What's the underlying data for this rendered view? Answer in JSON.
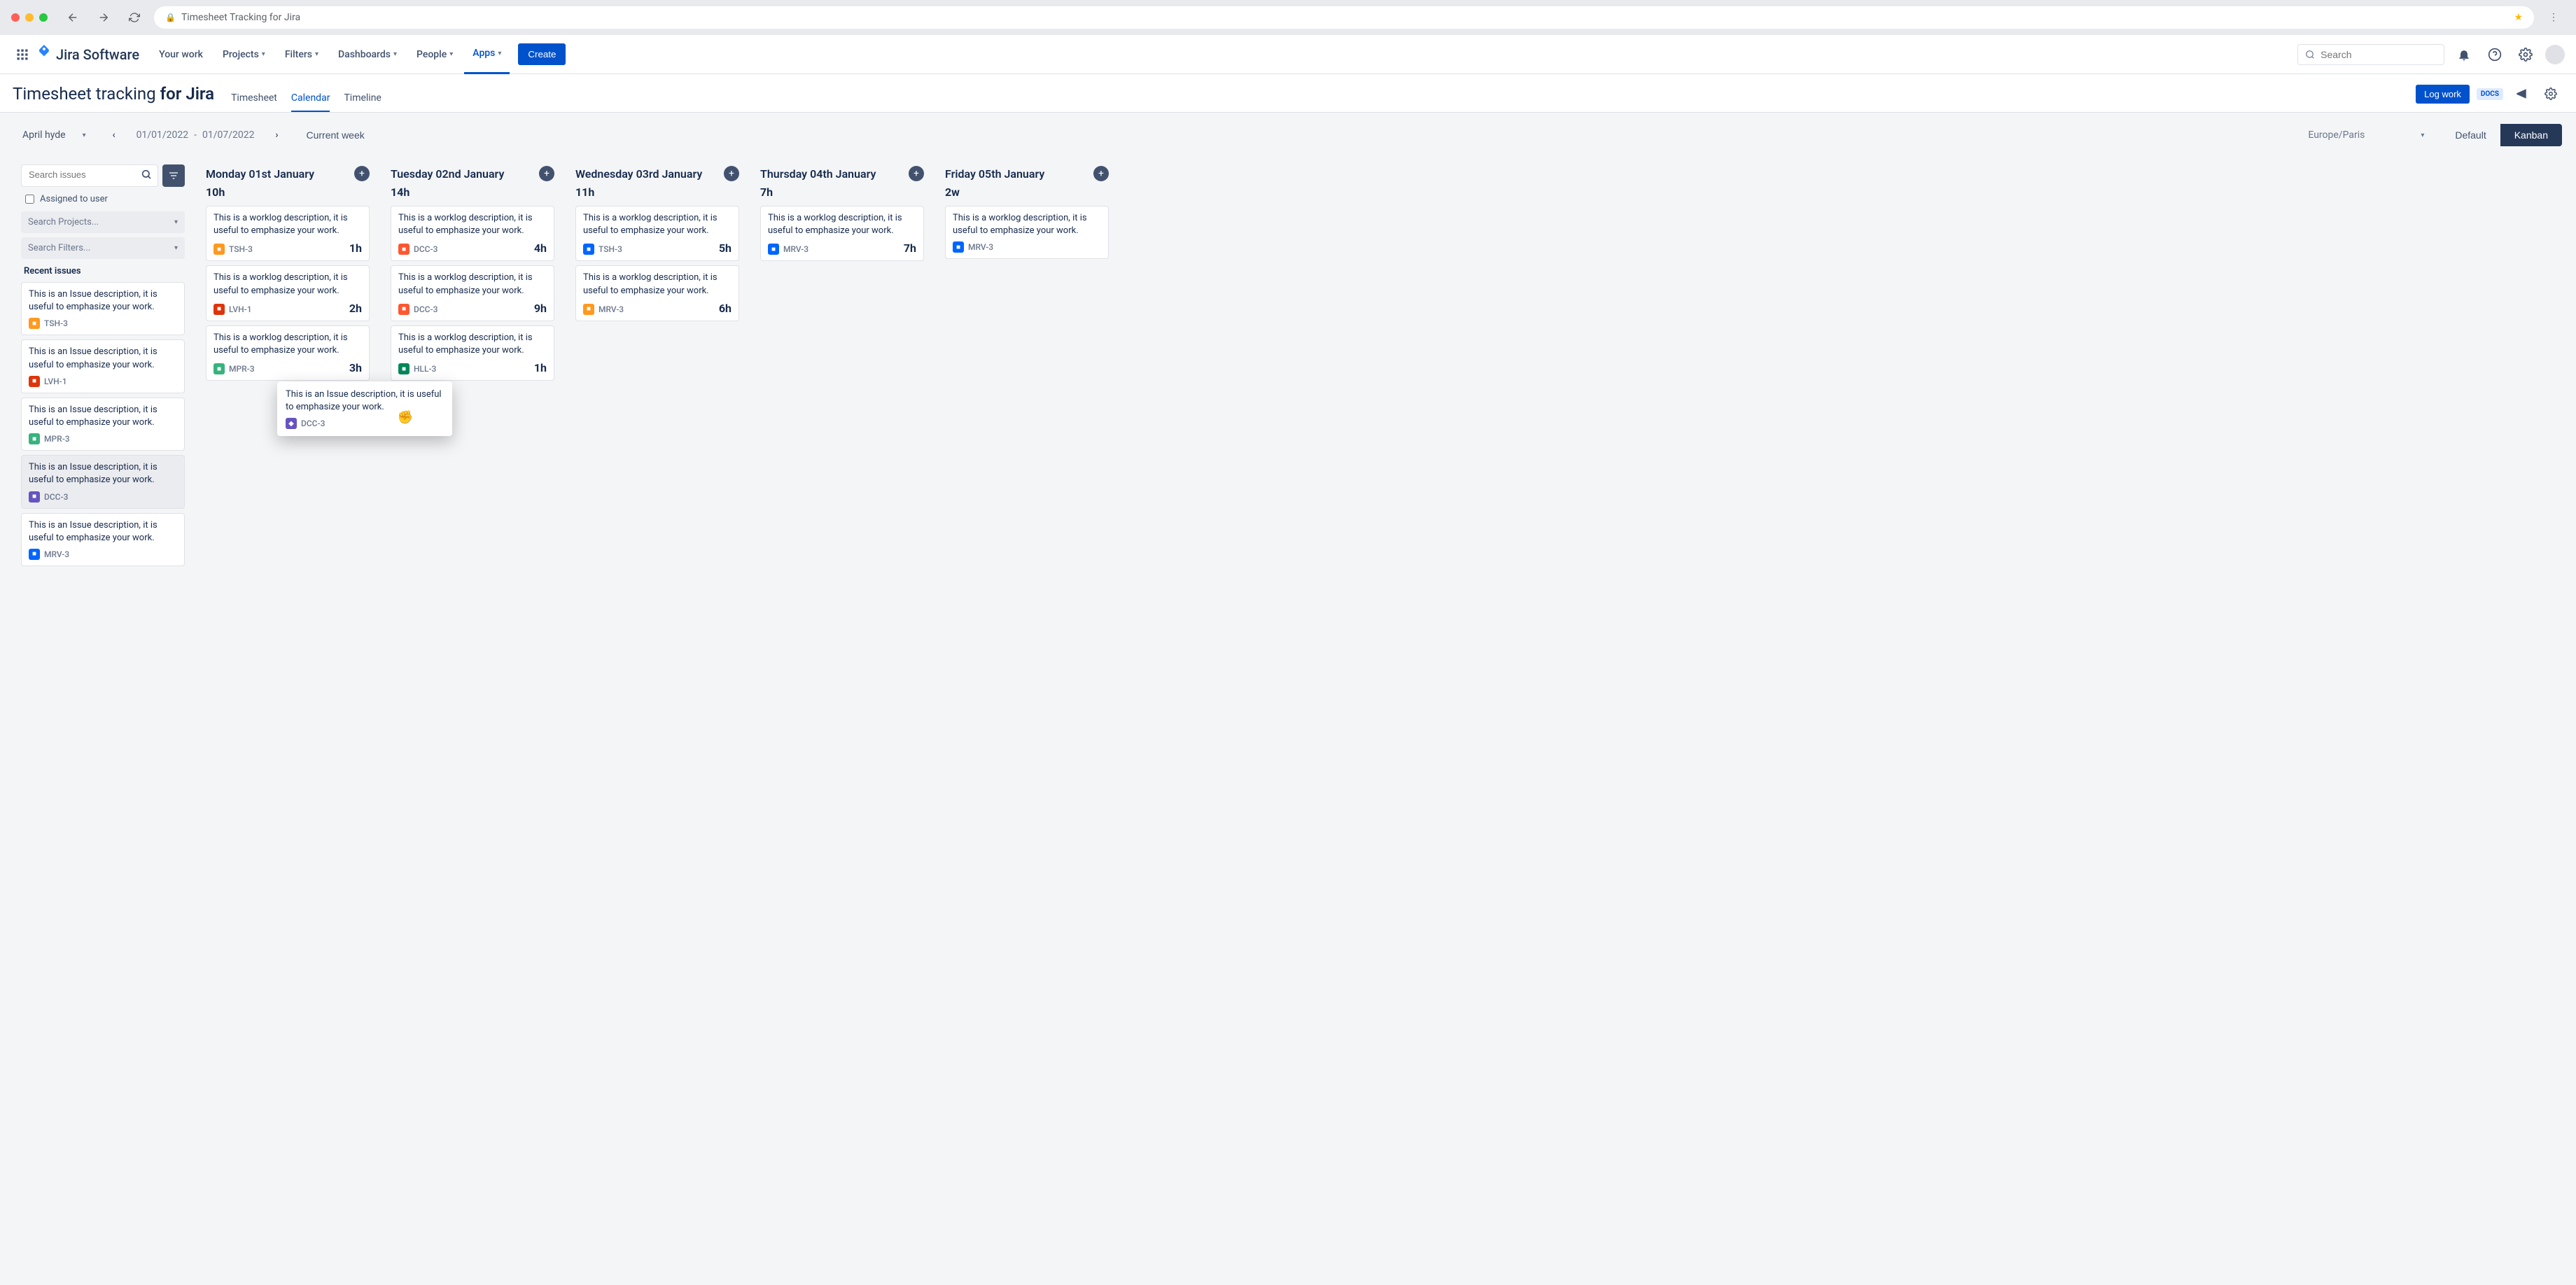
{
  "browser": {
    "page_title": "Timesheet Tracking for Jira"
  },
  "topnav": {
    "product": "Jira Software",
    "items": [
      "Your work",
      "Projects",
      "Filters",
      "Dashboards",
      "People",
      "Apps"
    ],
    "active_item": "Apps",
    "create_label": "Create",
    "search_placeholder": "Search"
  },
  "page": {
    "title_prefix": "Timesheet tracking ",
    "title_suffix": "for Jira",
    "tabs": [
      "Timesheet",
      "Calendar",
      "Timeline"
    ],
    "active_tab": "Calendar",
    "log_work_label": "Log work",
    "docs_label": "DOCS"
  },
  "filters": {
    "user": "April hyde",
    "date_from": "01/01/2022",
    "date_to": "01/07/2022",
    "date_sep": "-",
    "current_week": "Current week",
    "timezone": "Europe/Paris",
    "view_default": "Default",
    "view_kanban": "Kanban"
  },
  "sidebar": {
    "search_placeholder": "Search issues",
    "assigned_label": "Assigned to user",
    "projects_placeholder": "Search Projects...",
    "filters_placeholder": "Search Filters...",
    "recent_label": "Recent issues",
    "issues": [
      {
        "desc": "This is an Issue description, it is useful to emphasize your work.",
        "key": "TSH-3",
        "color": "ti-orange"
      },
      {
        "desc": "This is an Issue description, it is useful to emphasize your work.",
        "key": "LVH-1",
        "color": "ti-red"
      },
      {
        "desc": "This is an Issue description, it is useful to emphasize your work.",
        "key": "MPR-3",
        "color": "ti-green"
      },
      {
        "desc": "This is an Issue description, it is useful to emphasize your work.",
        "key": "DCC-3",
        "color": "ti-purple",
        "dragged": true
      },
      {
        "desc": "This is an Issue description, it is useful to emphasize your work.",
        "key": "MRV-3",
        "color": "ti-blue"
      }
    ]
  },
  "days": [
    {
      "title": "Monday 01st January",
      "hours": "10h",
      "worklogs": [
        {
          "desc": "This is a worklog description, it is useful to emphasize your work.",
          "key": "TSH-3",
          "color": "ti-orange",
          "hours": "1h"
        },
        {
          "desc": "This is a worklog description, it is useful to emphasize your work.",
          "key": "LVH-1",
          "color": "ti-red",
          "hours": "2h"
        },
        {
          "desc": "This is a worklog description, it is useful to emphasize your work.",
          "key": "MPR-3",
          "color": "ti-green",
          "hours": "3h"
        }
      ]
    },
    {
      "title": "Tuesday 02nd January",
      "hours": "14h",
      "worklogs": [
        {
          "desc": "This is a worklog description, it is useful to emphasize your work.",
          "key": "DCC-3",
          "color": "ti-red2",
          "hours": "4h"
        },
        {
          "desc": "This is a worklog description, it is useful to emphasize your work.",
          "key": "DCC-3",
          "color": "ti-red2",
          "hours": "9h"
        },
        {
          "desc": "This is a worklog description, it is useful to emphasize your work.",
          "key": "HLL-3",
          "color": "ti-green2",
          "hours": "1h"
        }
      ]
    },
    {
      "title": "Wednesday 03rd January",
      "hours": "11h",
      "worklogs": [
        {
          "desc": "This is a worklog description, it is useful to emphasize your work.",
          "key": "TSH-3",
          "color": "ti-blue",
          "hours": "5h"
        },
        {
          "desc": "This is a worklog description, it is useful to emphasize your work.",
          "key": "MRV-3",
          "color": "ti-orange",
          "hours": "6h"
        }
      ]
    },
    {
      "title": "Thursday 04th January",
      "hours": "7h",
      "worklogs": [
        {
          "desc": "This is a worklog description, it is useful to emphasize your work.",
          "key": "MRV-3",
          "color": "ti-blue",
          "hours": "7h"
        }
      ]
    },
    {
      "title": "Friday 05th January",
      "hours": "2w",
      "worklogs": [
        {
          "desc": "This is a worklog description, it is useful to emphasize your work.",
          "key": "MRV-3",
          "color": "ti-blue",
          "hours": ""
        }
      ]
    }
  ],
  "drag_ghost": {
    "desc": "This is an Issue description, it is useful to emphasize your work.",
    "key": "DCC-3",
    "color": "ti-purple"
  }
}
